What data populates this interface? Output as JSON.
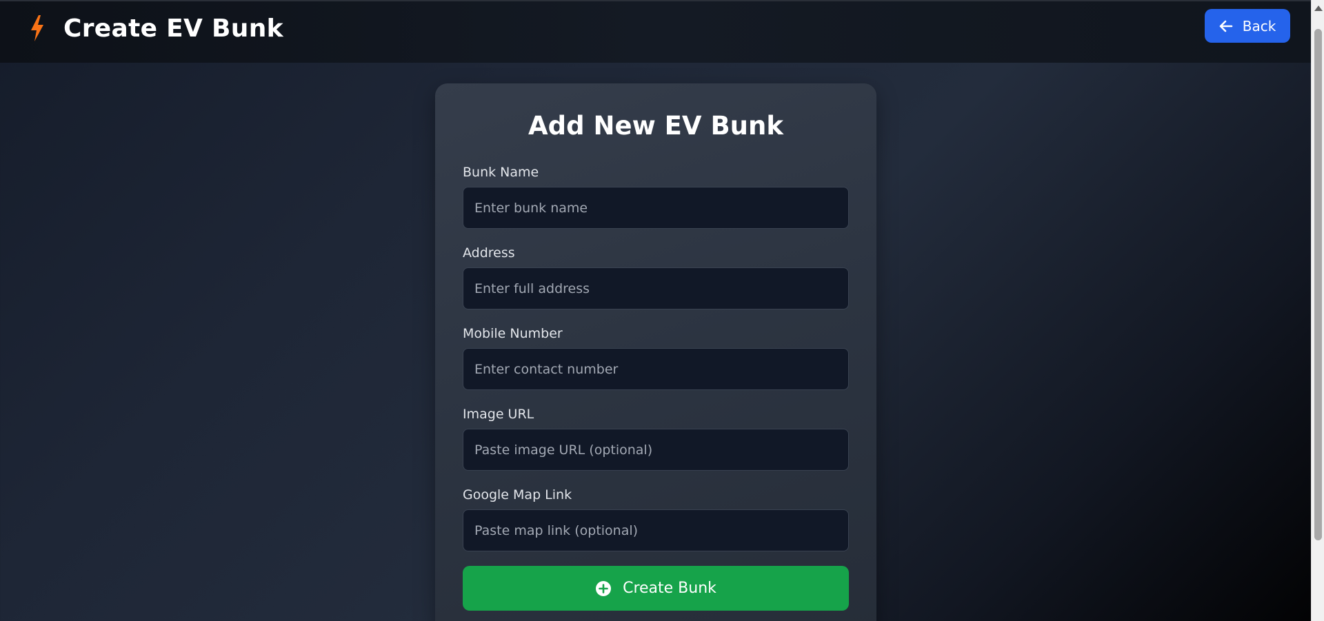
{
  "header": {
    "title": "Create EV Bunk",
    "logo_icon": "lightning-bolt-icon",
    "back_label": "Back",
    "back_icon": "arrow-left-icon"
  },
  "form": {
    "title": "Add New EV Bunk",
    "fields": [
      {
        "label": "Bunk Name",
        "placeholder": "Enter bunk name",
        "value": ""
      },
      {
        "label": "Address",
        "placeholder": "Enter full address",
        "value": ""
      },
      {
        "label": "Mobile Number",
        "placeholder": "Enter contact number",
        "value": ""
      },
      {
        "label": "Image URL",
        "placeholder": "Paste image URL (optional)",
        "value": ""
      },
      {
        "label": "Google Map Link",
        "placeholder": "Paste map link (optional)",
        "value": ""
      }
    ],
    "submit_label": "Create Bunk",
    "submit_icon": "plus-circle-icon"
  },
  "colors": {
    "accent_blue": "#2563eb",
    "accent_green": "#16a34a",
    "bolt_orange": "#f97316",
    "input_bg": "#111827"
  }
}
